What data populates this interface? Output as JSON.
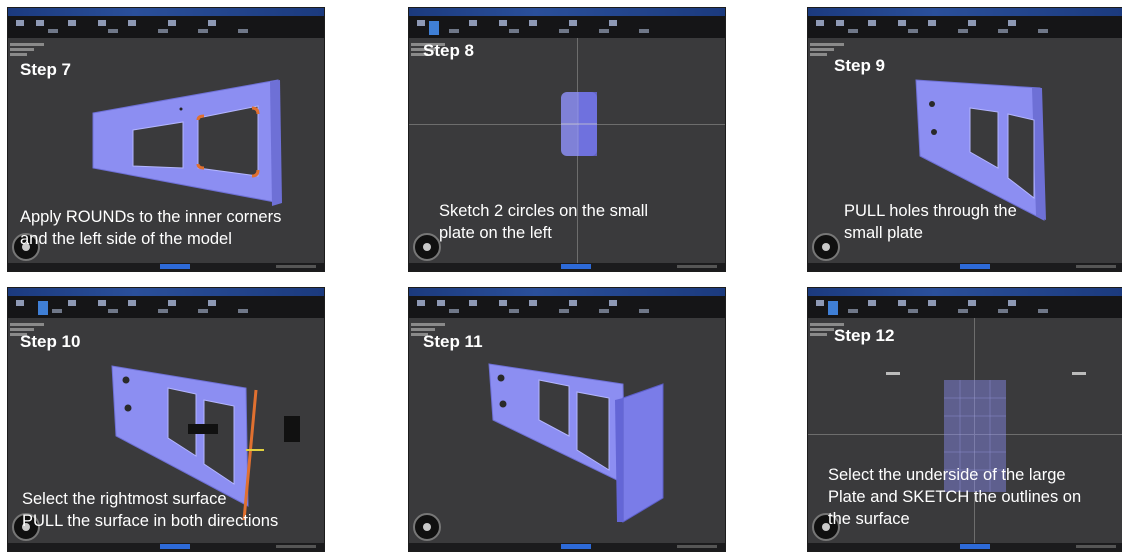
{
  "steps": [
    {
      "label": "Step 7",
      "caption": "Apply ROUNDs to the inner corners\nand the left side of the model"
    },
    {
      "label": "Step 8",
      "caption": "Sketch 2 circles on the small\nplate on the left"
    },
    {
      "label": "Step 9",
      "caption": "PULL holes through the\nsmall plate"
    },
    {
      "label": "Step 10",
      "caption": "Select the rightmost surface\nPULL the surface in both directions"
    },
    {
      "label": "Step 11",
      "caption": ""
    },
    {
      "label": "Step 12",
      "caption": "Select the underside of the large\nPlate and SKETCH the outlines on\nthe surface"
    }
  ],
  "colors": {
    "viewport": "#3a3a3c",
    "model": "#8c8ef2",
    "highlight": "#e07030",
    "titlebar": "#1e3c7a"
  }
}
